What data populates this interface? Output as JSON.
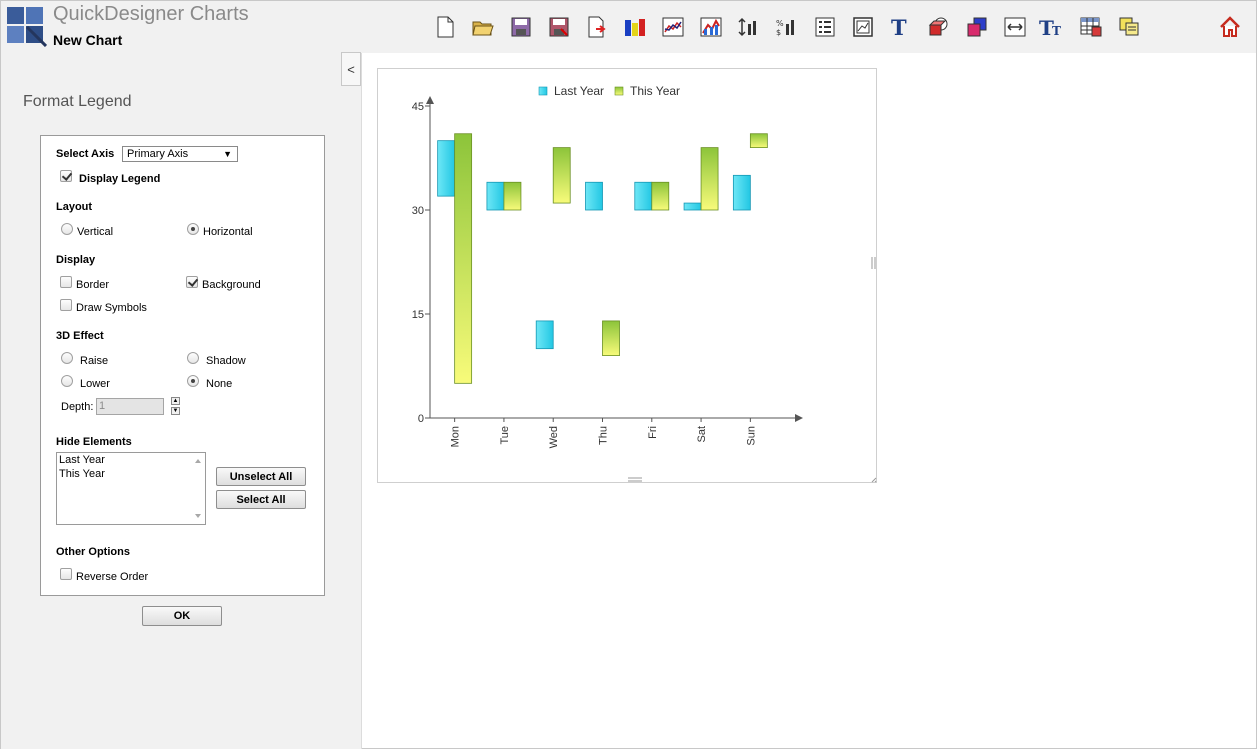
{
  "app": {
    "name": "QuickDesigner Charts",
    "document": "New Chart"
  },
  "toolbar": {
    "icons": [
      "new-document-icon",
      "open-folder-icon",
      "save-icon",
      "save-as-icon",
      "export-icon",
      "color-palette-icon",
      "line-chart-icon",
      "area-chart-icon",
      "axis-scale-icon",
      "data-labels-icon",
      "legend-icon",
      "chart-background-icon",
      "title-text-icon",
      "3d-effect-icon",
      "series-color-icon",
      "width-resize-icon",
      "font-size-icon",
      "data-table-icon",
      "copy-icon",
      "home-icon"
    ]
  },
  "sidebar": {
    "collapse_label": "<",
    "panel_title": "Format Legend",
    "select_axis_label": "Select Axis",
    "axis_value": "Primary Axis",
    "display_legend_label": "Display Legend",
    "layout_header": "Layout",
    "vertical_label": "Vertical",
    "horizontal_label": "Horizontal",
    "display_header": "Display",
    "border_label": "Border",
    "background_label": "Background",
    "draw_symbols_label": "Draw Symbols",
    "effect_header": "3D Effect",
    "raise_label": "Raise",
    "shadow_label": "Shadow",
    "lower_label": "Lower",
    "none_label": "None",
    "depth_label": "Depth:",
    "depth_value": "1",
    "hide_header": "Hide Elements",
    "hide_items": [
      "Last Year",
      "This Year"
    ],
    "unselect_all_label": "Unselect All",
    "select_all_label": "Select All",
    "other_header": "Other Options",
    "reverse_order_label": "Reverse Order",
    "ok_label": "OK",
    "state": {
      "display_legend": true,
      "layout": "horizontal",
      "border": false,
      "background": true,
      "draw_symbols": false,
      "effect": "none",
      "reverse_order": false
    }
  },
  "chart_data": {
    "type": "bar",
    "subtype": "floating-range",
    "categories": [
      "Mon",
      "Tue",
      "Wed",
      "Thu",
      "Fri",
      "Sat",
      "Sun"
    ],
    "series": [
      {
        "name": "Last Year",
        "color": "#2ed3ec",
        "ranges": [
          [
            32,
            40
          ],
          [
            30,
            34
          ],
          [
            10,
            14
          ],
          [
            30,
            34
          ],
          [
            30,
            34
          ],
          [
            30,
            31
          ],
          [
            30,
            35
          ]
        ]
      },
      {
        "name": "This Year",
        "color": "#9ed13a",
        "ranges": [
          [
            5,
            41
          ],
          [
            30,
            34
          ],
          [
            31,
            39
          ],
          [
            9,
            14
          ],
          [
            30,
            34
          ],
          [
            30,
            39
          ],
          [
            39,
            41
          ]
        ]
      }
    ],
    "yticks": [
      0,
      15,
      30,
      45
    ],
    "ylim": [
      0,
      45
    ],
    "legend_position": "top-center",
    "grid": false
  }
}
